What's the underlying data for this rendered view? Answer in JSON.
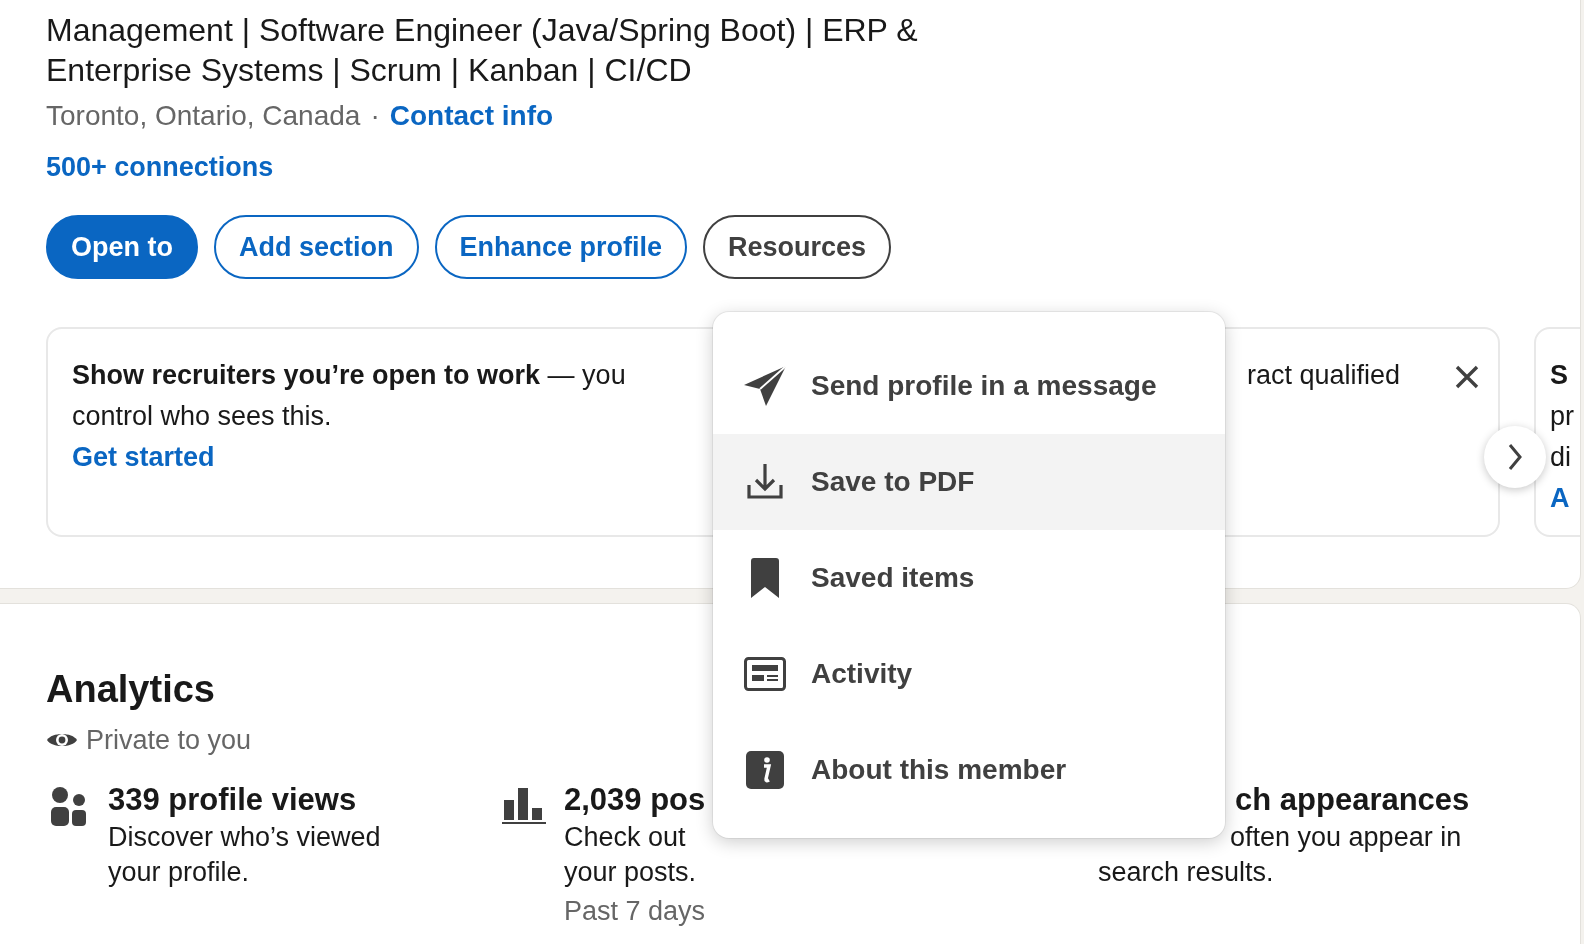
{
  "profile": {
    "headline_lines": [
      "Management | Software Engineer (Java/Spring Boot) | ERP &",
      "Enterprise Systems | Scrum | Kanban | CI/CD"
    ],
    "location": "Toronto, Ontario, Canada",
    "separator": "·",
    "contact_link": "Contact info",
    "connections": "500+ connections",
    "actions": [
      {
        "label": "Open to",
        "kind": "primary"
      },
      {
        "label": "Add section",
        "kind": "outline"
      },
      {
        "label": "Enhance profile",
        "kind": "outline"
      },
      {
        "label": "Resources",
        "kind": "neutral"
      }
    ],
    "suggestion_cards": [
      {
        "text": "**Show recruiters you’re open to work** — you control who sees this.",
        "link": "Get started"
      },
      {
        "lines": [
          "ract qualified"
        ],
        "dismissable": true
      },
      {
        "lines": [
          "S",
          "pr",
          "di"
        ],
        "link": "A"
      }
    ]
  },
  "resources_menu": {
    "items": [
      {
        "label": "Send profile in a message",
        "selected": false
      },
      {
        "label": "Save to PDF",
        "selected": true
      },
      {
        "label": "Saved items",
        "selected": false
      },
      {
        "label": "Activity",
        "selected": false
      },
      {
        "label": "About this member",
        "selected": false
      }
    ]
  },
  "analytics": {
    "title": "Analytics",
    "privacy": "Private to you",
    "stats": [
      {
        "title": "339 profile views",
        "lines": [
          "Discover who’s viewed",
          "your profile."
        ]
      },
      {
        "title": "2,039 pos",
        "lines": [
          "Check out",
          "your posts."
        ],
        "note": "Past 7 days"
      },
      {
        "title": "ch appearances",
        "lines": [
          "often you appear in",
          "search results."
        ]
      }
    ]
  }
}
